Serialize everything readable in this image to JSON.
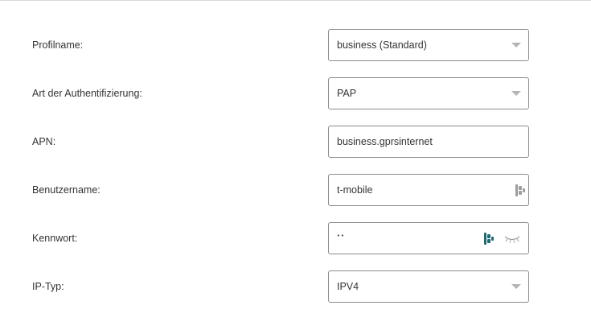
{
  "form": {
    "rows": [
      {
        "label": "Profilname:",
        "value": "business (Standard)",
        "control": "select"
      },
      {
        "label": "Art der Authentifizierung:",
        "value": "PAP",
        "control": "select"
      },
      {
        "label": "APN:",
        "value": "business.gprsinternet",
        "control": "text"
      },
      {
        "label": "Benutzername:",
        "value": "t-mobile",
        "control": "text"
      },
      {
        "label": "Kennwort:",
        "value": "··",
        "control": "password"
      },
      {
        "label": "IP-Typ:",
        "value": "IPV4",
        "control": "select"
      }
    ]
  },
  "icons": {
    "select_arrow": "chevron-down-icon",
    "autofill": "password-manager-icon",
    "visibility": "eye-closed-icon"
  },
  "colors": {
    "autofill_icon_active": "#1f6b73",
    "autofill_icon_inactive": "#9e9e9e",
    "field_border": "#8c8c8c",
    "caret": "#b5b5b5"
  }
}
